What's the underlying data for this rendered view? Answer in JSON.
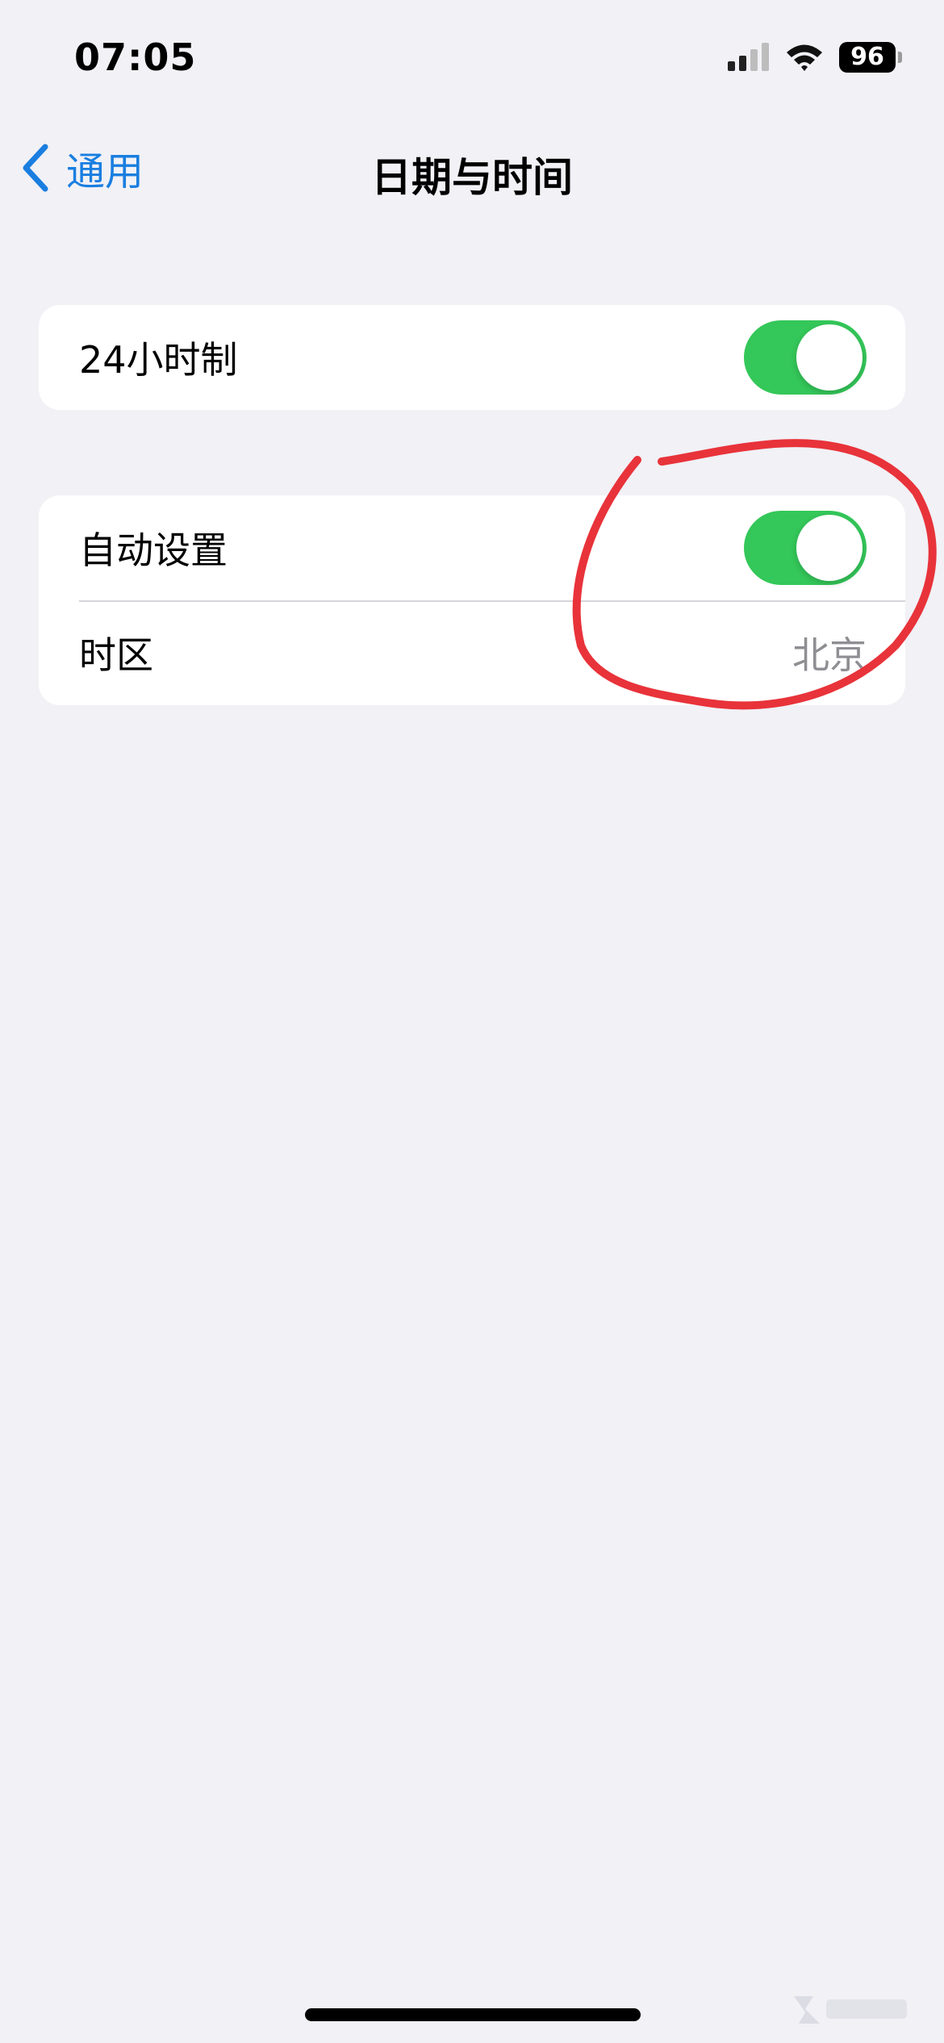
{
  "status_bar": {
    "time": "07:05",
    "battery": "96",
    "icons": [
      "signal-icon",
      "wifi-icon",
      "battery-icon"
    ]
  },
  "nav": {
    "back_label": "通用",
    "title": "日期与时间",
    "back_icon": "chevron-left-icon"
  },
  "settings": {
    "hour24": {
      "label": "24小时制",
      "on": true
    },
    "auto_set": {
      "label": "自动设置",
      "on": true
    },
    "timezone": {
      "label": "时区",
      "value": "北京"
    }
  },
  "colors": {
    "background": "#f1f1f6",
    "accent": "#1a7ee0",
    "toggle_on": "#34c759",
    "annotation": "#e8333a",
    "secondary_text": "#8e8e93"
  }
}
